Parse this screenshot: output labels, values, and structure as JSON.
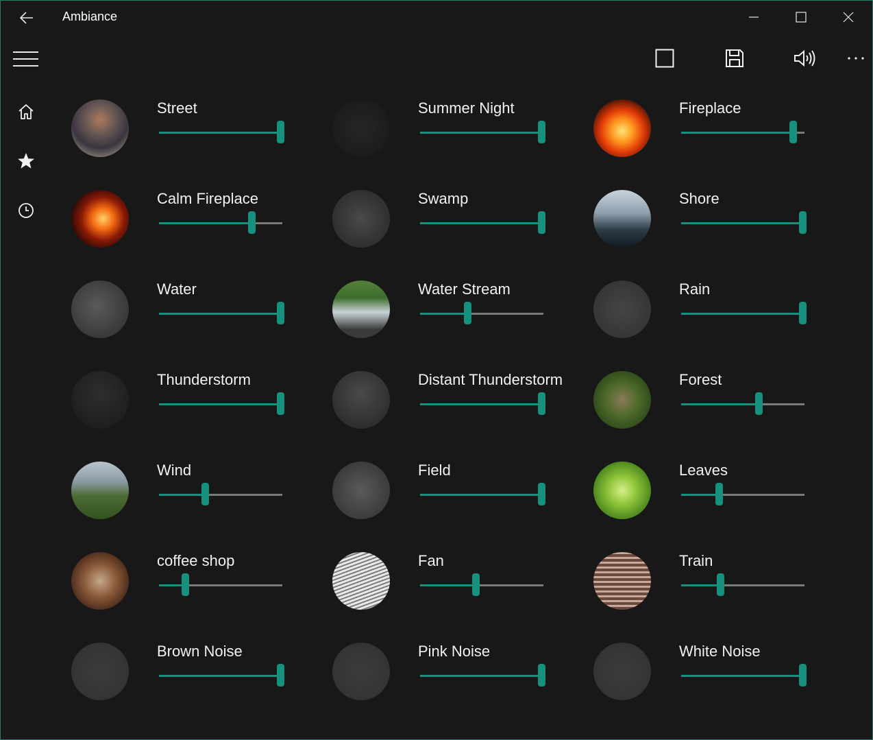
{
  "app": {
    "title": "Ambiance",
    "accent_color": "#17907d",
    "background_color": "#181818"
  },
  "titlebar": {
    "back_icon": "back-arrow-icon",
    "minimize_icon": "minimize-icon",
    "maximize_icon": "maximize-icon",
    "close_icon": "close-icon"
  },
  "commandbar": {
    "menu_icon": "hamburger-icon",
    "buttons": [
      {
        "icon": "stop-square-icon"
      },
      {
        "icon": "save-icon"
      },
      {
        "icon": "volume-icon"
      },
      {
        "icon": "more-icon"
      }
    ]
  },
  "nav": {
    "items": [
      {
        "icon": "home-icon"
      },
      {
        "icon": "favorites-star-icon"
      },
      {
        "icon": "history-clock-icon"
      }
    ]
  },
  "sounds": [
    {
      "name": "Street",
      "volume": 1.0,
      "art": "street"
    },
    {
      "name": "Summer Night",
      "volume": 1.0,
      "art": "night"
    },
    {
      "name": "Fireplace",
      "volume": 0.92,
      "art": "fire"
    },
    {
      "name": "Calm Fireplace",
      "volume": 0.76,
      "art": "fire2"
    },
    {
      "name": "Swamp",
      "volume": 1.0,
      "art": "swamp"
    },
    {
      "name": "Shore",
      "volume": 1.0,
      "art": "shore"
    },
    {
      "name": "Water",
      "volume": 1.0,
      "art": "water"
    },
    {
      "name": "Water Stream",
      "volume": 0.38,
      "art": "stream"
    },
    {
      "name": "Rain",
      "volume": 1.0,
      "art": "rain"
    },
    {
      "name": "Thunderstorm",
      "volume": 1.0,
      "art": "storm"
    },
    {
      "name": "Distant Thunderstorm",
      "volume": 1.0,
      "art": "distant"
    },
    {
      "name": "Forest",
      "volume": 0.63,
      "art": "forest"
    },
    {
      "name": "Wind",
      "volume": 0.37,
      "art": "wind"
    },
    {
      "name": "Field",
      "volume": 1.0,
      "art": "field"
    },
    {
      "name": "Leaves",
      "volume": 0.3,
      "art": "leaves"
    },
    {
      "name": "coffee shop",
      "volume": 0.2,
      "art": "coffee"
    },
    {
      "name": "Fan",
      "volume": 0.45,
      "art": "fan"
    },
    {
      "name": "Train",
      "volume": 0.31,
      "art": "train"
    },
    {
      "name": "Brown Noise",
      "volume": 1.0,
      "art": "noise"
    },
    {
      "name": "Pink Noise",
      "volume": 1.0,
      "art": "noise"
    },
    {
      "name": "White Noise",
      "volume": 1.0,
      "art": "noise"
    }
  ]
}
